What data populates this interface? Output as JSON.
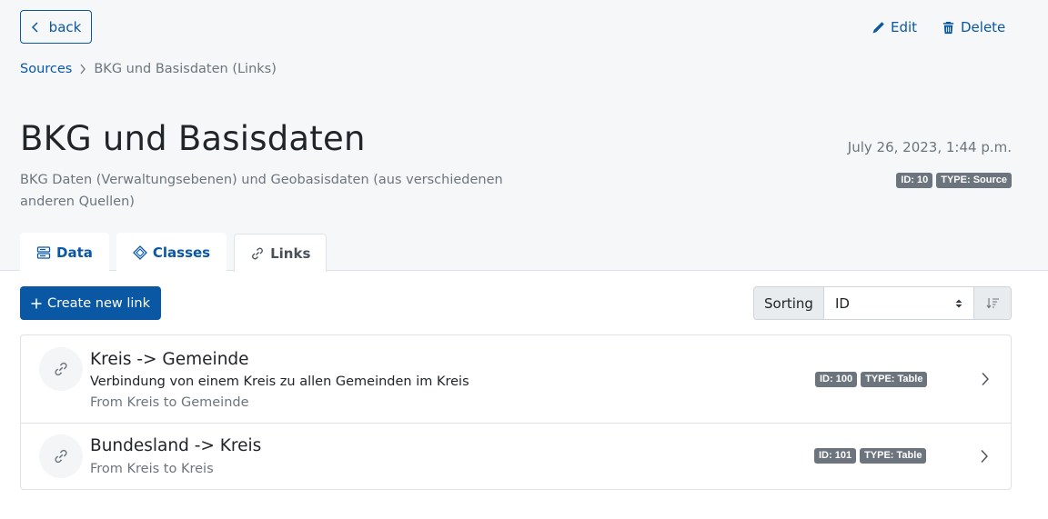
{
  "header": {
    "back_label": "back",
    "edit_label": "Edit",
    "delete_label": "Delete"
  },
  "breadcrumb": {
    "root": "Sources",
    "current": "BKG und Basisdaten (Links)"
  },
  "page": {
    "title": "BKG und Basisdaten",
    "description": "BKG Daten (Verwaltungsebenen) und Geobasisdaten (aus verschiedenen anderen Quellen)",
    "date": "July 26, 2023, 1:44 p.m.",
    "id_badge": "ID: 10",
    "type_badge": "TYPE: Source"
  },
  "tabs": [
    {
      "label": "Data",
      "icon": "database-icon",
      "active": false
    },
    {
      "label": "Classes",
      "icon": "diamond-icon",
      "active": false
    },
    {
      "label": "Links",
      "icon": "link-icon",
      "active": true
    }
  ],
  "toolbar": {
    "create_label": "Create new link",
    "sort_label": "Sorting",
    "sort_value": "ID"
  },
  "links": [
    {
      "title": "Kreis -> Gemeinde",
      "description": "Verbindung von einem Kreis zu allen Gemeinden im Kreis",
      "from": "From Kreis to Gemeinde",
      "id_badge": "ID: 100",
      "type_badge": "TYPE: Table"
    },
    {
      "title": "Bundesland -> Kreis",
      "from": "From Kreis to Kreis",
      "id_badge": "ID: 101",
      "type_badge": "TYPE: Table"
    }
  ],
  "colors": {
    "accent": "#0a58a3",
    "badge": "#6c757d",
    "background_top": "#f6f7f9"
  }
}
